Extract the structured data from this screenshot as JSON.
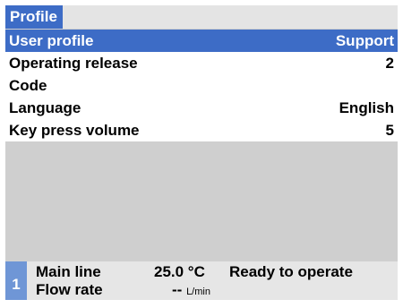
{
  "header": {
    "title": "Profile"
  },
  "menu": {
    "items": [
      {
        "label": "User profile",
        "value": "Support",
        "selected": true
      },
      {
        "label": "Operating release",
        "value": "2"
      },
      {
        "label": "Code",
        "value": ""
      },
      {
        "label": "Language",
        "value": "English"
      },
      {
        "label": "Key press volume",
        "value": "5"
      }
    ]
  },
  "status": {
    "channel": "1",
    "line1_label": "Main line",
    "line1_value": "25.0 °C",
    "line2_label": "Flow rate",
    "line2_value": "--",
    "line2_unit": "L/min",
    "state": "Ready to operate"
  },
  "colors": {
    "selection": "#3d6cc6",
    "channel_badge": "#6f96d6",
    "panel": "#cfcfcf"
  }
}
